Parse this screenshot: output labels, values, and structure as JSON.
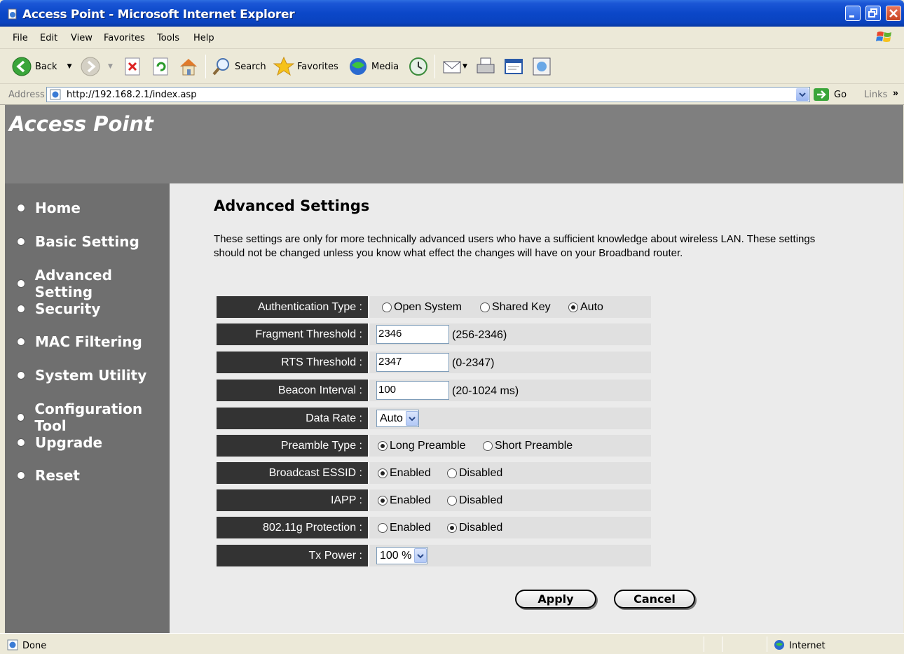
{
  "window": {
    "title": "Access Point - Microsoft Internet Explorer"
  },
  "menu": {
    "items": [
      "File",
      "Edit",
      "View",
      "Favorites",
      "Tools",
      "Help"
    ]
  },
  "toolbar": {
    "back": "Back",
    "search": "Search",
    "favorites": "Favorites",
    "media": "Media"
  },
  "address": {
    "label": "Address",
    "url": "http://192.168.2.1/index.asp",
    "go": "Go",
    "links": "Links"
  },
  "banner": {
    "brand": "Access Point"
  },
  "sidebar": {
    "items": [
      {
        "label": "Home"
      },
      {
        "label": "Basic Setting"
      },
      {
        "label": "Advanced Setting"
      },
      {
        "label": "Security"
      },
      {
        "label": "MAC Filtering"
      },
      {
        "label": "System Utility"
      },
      {
        "label": "Configuration Tool"
      },
      {
        "label": "Upgrade"
      },
      {
        "label": "Reset"
      }
    ]
  },
  "main": {
    "heading": "Advanced Settings",
    "description": "These settings are only for more technically advanced users who have a sufficient knowledge about wireless LAN. These settings should not be changed unless you know what effect the changes will have on your Broadband router.",
    "auth": {
      "label": "Authentication Type :",
      "options": [
        "Open System",
        "Shared Key",
        "Auto"
      ],
      "selected": "Auto"
    },
    "fragment": {
      "label": "Fragment Threshold :",
      "value": "2346",
      "hint": "(256-2346)"
    },
    "rts": {
      "label": "RTS Threshold :",
      "value": "2347",
      "hint": "(0-2347)"
    },
    "beacon": {
      "label": "Beacon Interval :",
      "value": "100",
      "hint": "(20-1024 ms)"
    },
    "datarate": {
      "label": "Data Rate :",
      "value": "Auto"
    },
    "preamble": {
      "label": "Preamble Type :",
      "options": [
        "Long Preamble",
        "Short Preamble"
      ],
      "selected": "Long Preamble"
    },
    "essid": {
      "label": "Broadcast ESSID :",
      "options": [
        "Enabled",
        "Disabled"
      ],
      "selected": "Enabled"
    },
    "iapp": {
      "label": "IAPP :",
      "options": [
        "Enabled",
        "Disabled"
      ],
      "selected": "Enabled"
    },
    "protection": {
      "label": "802.11g Protection :",
      "options": [
        "Enabled",
        "Disabled"
      ],
      "selected": "Disabled"
    },
    "txpower": {
      "label": "Tx Power :",
      "value": "100 %"
    },
    "apply": "Apply",
    "cancel": "Cancel"
  },
  "status": {
    "text": "Done",
    "zone": "Internet"
  },
  "colors": {
    "banner": "#7f7f7f",
    "sidebar": "#6f6f6f",
    "label_bg": "#333333",
    "main_bg": "#ebebeb"
  }
}
